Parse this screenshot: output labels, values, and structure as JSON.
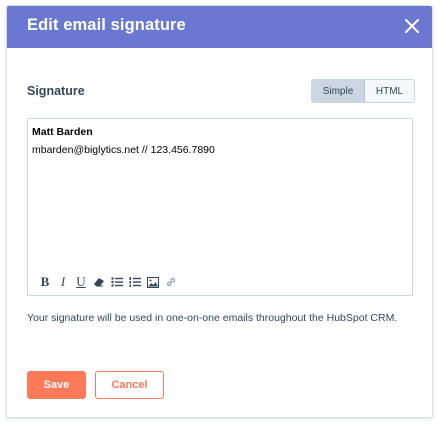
{
  "modal": {
    "title": "Edit email signature",
    "close_icon": "close-icon"
  },
  "signature": {
    "label": "Signature",
    "modes": [
      {
        "label": "Simple",
        "selected": true
      },
      {
        "label": "HTML",
        "selected": false
      }
    ]
  },
  "editor": {
    "name_line": "Matt Barden",
    "contact_line": "mbarden@biglytics.net // 123.456.7890",
    "toolbar": [
      {
        "icon": "bold-icon",
        "glyph": "B"
      },
      {
        "icon": "italic-icon",
        "glyph": "I"
      },
      {
        "icon": "underline-icon",
        "glyph": "U"
      },
      {
        "icon": "eraser-icon"
      },
      {
        "icon": "bulleted-list-icon"
      },
      {
        "icon": "numbered-list-icon"
      },
      {
        "icon": "image-icon"
      },
      {
        "icon": "link-icon"
      }
    ]
  },
  "helper": {
    "text": "Your signature will be used in one-on-one emails throughout the HubSpot CRM."
  },
  "footer": {
    "save_label": "Save",
    "cancel_label": "Cancel"
  },
  "colors": {
    "header": "#6a78d1",
    "primary": "#ff7a59",
    "text": "#33475b"
  }
}
